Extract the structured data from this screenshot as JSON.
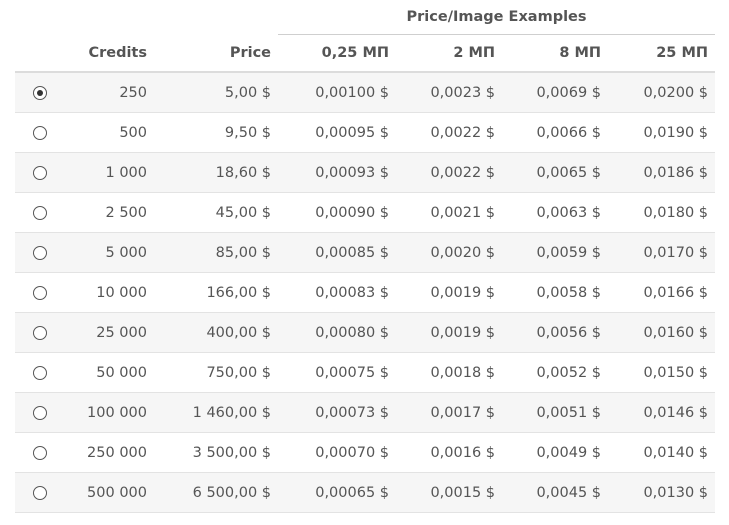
{
  "header": {
    "group_label": "Price/Image Examples",
    "columns": [
      "Credits",
      "Price",
      "0,25 МП",
      "2 МП",
      "8 МП",
      "25 МП"
    ]
  },
  "selected_index": 0,
  "rows": [
    {
      "credits": "250",
      "price": "5,00 $",
      "p1": "0,00100 $",
      "p2": "0,0023 $",
      "p3": "0,0069 $",
      "p4": "0,0200 $"
    },
    {
      "credits": "500",
      "price": "9,50 $",
      "p1": "0,00095 $",
      "p2": "0,0022 $",
      "p3": "0,0066 $",
      "p4": "0,0190 $"
    },
    {
      "credits": "1 000",
      "price": "18,60 $",
      "p1": "0,00093 $",
      "p2": "0,0022 $",
      "p3": "0,0065 $",
      "p4": "0,0186 $"
    },
    {
      "credits": "2 500",
      "price": "45,00 $",
      "p1": "0,00090 $",
      "p2": "0,0021 $",
      "p3": "0,0063 $",
      "p4": "0,0180 $"
    },
    {
      "credits": "5 000",
      "price": "85,00 $",
      "p1": "0,00085 $",
      "p2": "0,0020 $",
      "p3": "0,0059 $",
      "p4": "0,0170 $"
    },
    {
      "credits": "10 000",
      "price": "166,00 $",
      "p1": "0,00083 $",
      "p2": "0,0019 $",
      "p3": "0,0058 $",
      "p4": "0,0166 $"
    },
    {
      "credits": "25 000",
      "price": "400,00 $",
      "p1": "0,00080 $",
      "p2": "0,0019 $",
      "p3": "0,0056 $",
      "p4": "0,0160 $"
    },
    {
      "credits": "50 000",
      "price": "750,00 $",
      "p1": "0,00075 $",
      "p2": "0,0018 $",
      "p3": "0,0052 $",
      "p4": "0,0150 $"
    },
    {
      "credits": "100 000",
      "price": "1 460,00 $",
      "p1": "0,00073 $",
      "p2": "0,0017 $",
      "p3": "0,0051 $",
      "p4": "0,0146 $"
    },
    {
      "credits": "250 000",
      "price": "3 500,00 $",
      "p1": "0,00070 $",
      "p2": "0,0016 $",
      "p3": "0,0049 $",
      "p4": "0,0140 $"
    },
    {
      "credits": "500 000",
      "price": "6 500,00 $",
      "p1": "0,00065 $",
      "p2": "0,0015 $",
      "p3": "0,0045 $",
      "p4": "0,0130 $"
    }
  ]
}
